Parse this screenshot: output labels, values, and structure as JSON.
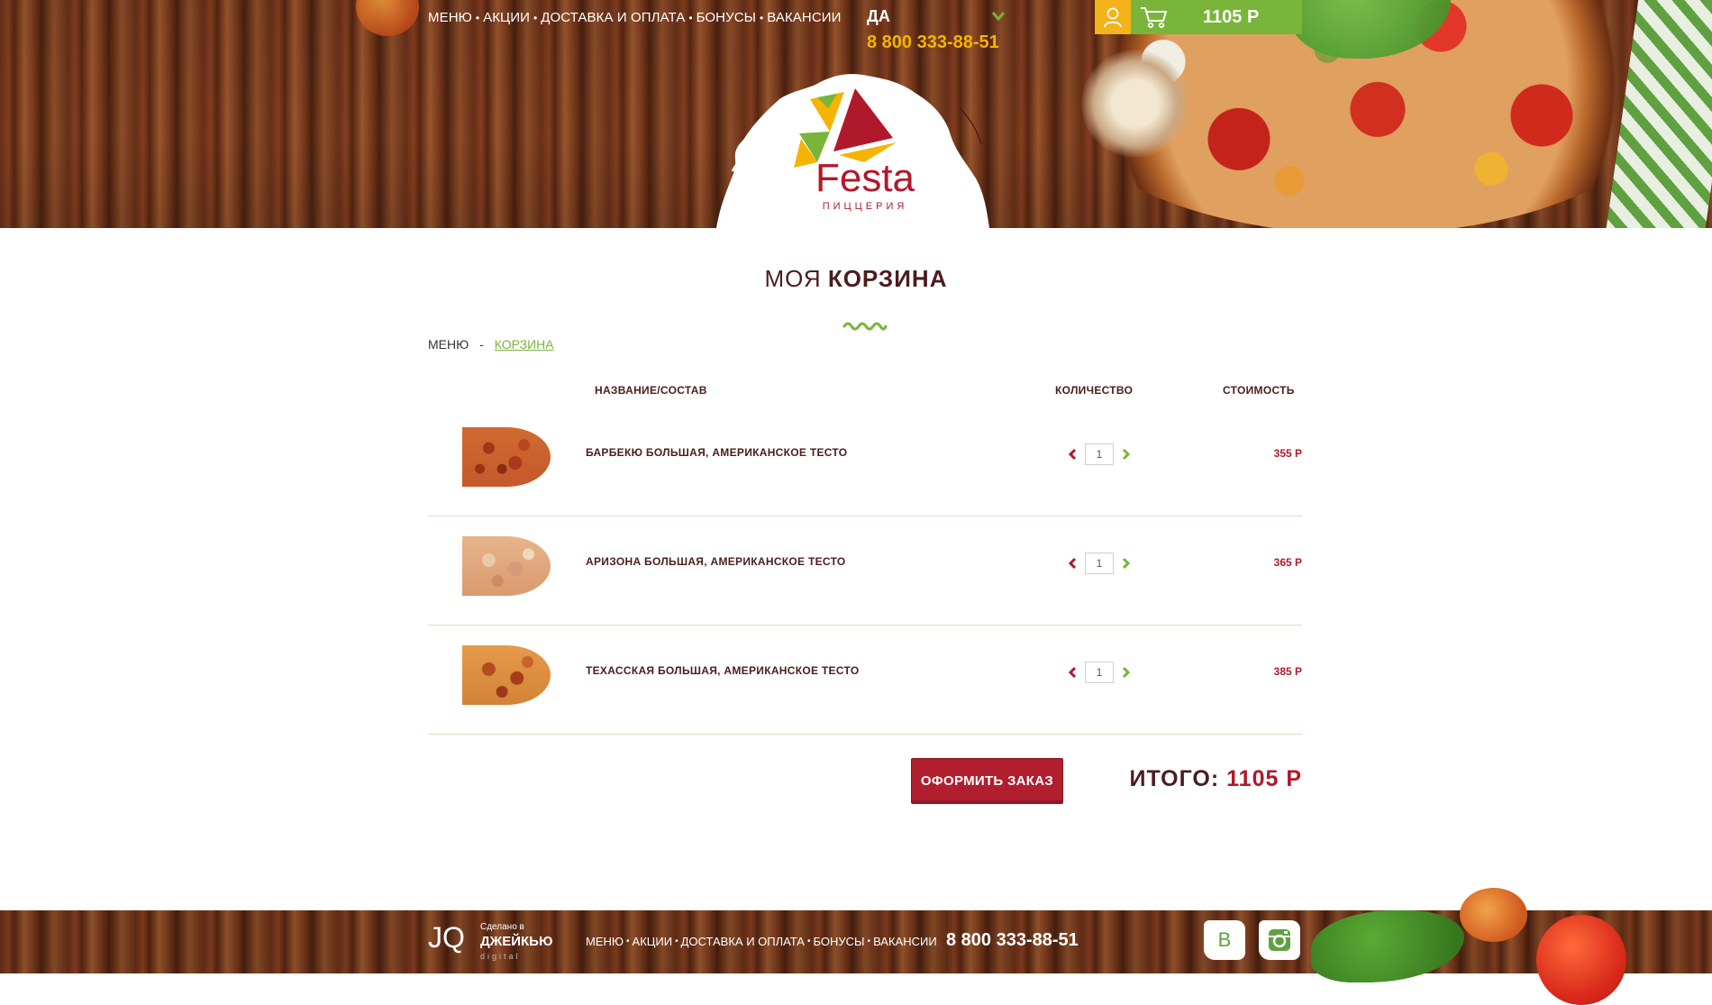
{
  "header": {
    "nav": [
      "МЕНЮ",
      "АКЦИИ",
      "ДОСТАВКА И ОПЛАТА",
      "БОНУСЫ",
      "ВАКАНСИИ"
    ],
    "city": "ДА",
    "phone": "8 800 333-88-51",
    "cart_total": "1105 Р",
    "icons": {
      "user": "user-icon",
      "cart": "cart-icon",
      "chevron": "chevron-down-icon"
    }
  },
  "logo": {
    "name": "Festa",
    "subtitle": "ПИЦЦЕРИЯ"
  },
  "page": {
    "title_light": "МОЯ",
    "title_bold": "КОРЗИНА"
  },
  "breadcrumb": {
    "parent": "МЕНЮ",
    "separator": "-",
    "current": "КОРЗИНА"
  },
  "table": {
    "headers": {
      "name": "НАЗВАНИЕ/СОСТАВ",
      "qty": "КОЛИЧЕСТВО",
      "price": "СТОИМОСТЬ"
    },
    "items": [
      {
        "name": "БАРБЕКЮ БОЛЬШАЯ, АМЕРИКАНСКОЕ ТЕСТО",
        "qty": "1",
        "price": "355 Р"
      },
      {
        "name": "АРИЗОНА БОЛЬШАЯ, АМЕРИКАНСКОЕ ТЕСТО",
        "qty": "1",
        "price": "365 Р"
      },
      {
        "name": "ТЕХАССКАЯ БОЛЬШАЯ, АМЕРИКАНСКОЕ ТЕСТО",
        "qty": "1",
        "price": "385 Р"
      }
    ]
  },
  "summary": {
    "checkout_label": "ОФОРМИТЬ ЗАКАЗ",
    "total_label": "ИТОГО:",
    "total_value": "1105 Р"
  },
  "footer": {
    "made_by": "Сделано в",
    "studio": "ДЖЕЙКЬЮ",
    "studio_sub": "digital",
    "studio_logo": "JQ",
    "nav": [
      "МЕНЮ",
      "АКЦИИ",
      "ДОСТАВКА И ОПЛАТА",
      "БОНУСЫ",
      "ВАКАНСИИ"
    ],
    "phone": "8 800 333-88-51",
    "vk_label": "В"
  },
  "colors": {
    "brand_red": "#b0192b",
    "brand_green": "#78b53a",
    "brand_yellow": "#f2b419",
    "text_dark": "#4b1d1d"
  }
}
